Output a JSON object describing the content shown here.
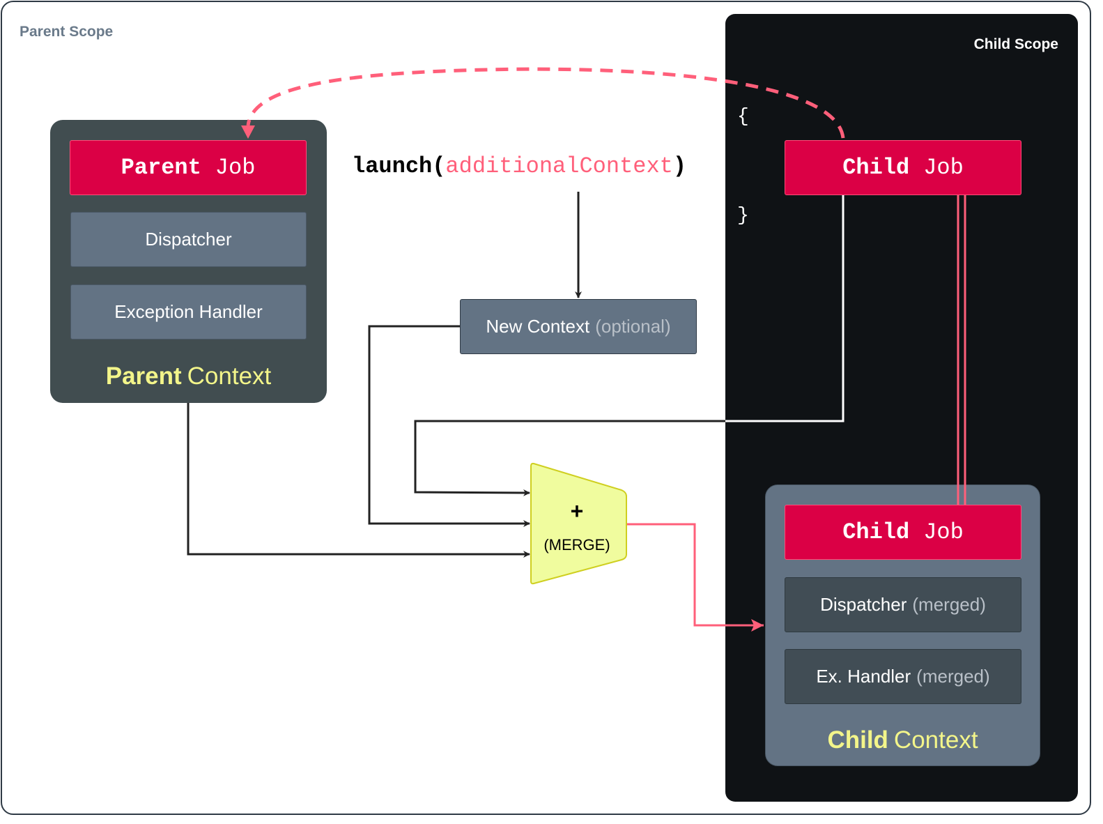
{
  "parent_scope": {
    "label": "Parent Scope"
  },
  "child_scope": {
    "label": "Child Scope",
    "open_brace": "{",
    "close_brace": "}"
  },
  "parent_context": {
    "job": {
      "bold": "Parent",
      "rest": "Job"
    },
    "dispatcher": "Dispatcher",
    "exception_handler": "Exception Handler",
    "label_bold": "Parent",
    "label_rest": "Context"
  },
  "launch": {
    "fn": "launch",
    "open": "(",
    "arg": "additionalContext",
    "close": ")"
  },
  "new_context": {
    "label": "New Context",
    "note": "(optional)"
  },
  "merge": {
    "symbol": "+",
    "label": "(MERGE)"
  },
  "child_job": {
    "bold": "Child",
    "rest": "Job"
  },
  "child_context": {
    "job": {
      "bold": "Child",
      "rest": "Job"
    },
    "dispatcher": "Dispatcher",
    "dispatcher_note": "(merged)",
    "handler": "Ex. Handler",
    "handler_note": "(merged)",
    "label_bold": "Child",
    "label_rest": "Context"
  },
  "colors": {
    "job": "#db0045",
    "accent_pink": "#ff5f7a",
    "context_label": "#f3f58a",
    "merge_fill": "#f0fc9e",
    "child_scope_bg": "#0f1215"
  }
}
